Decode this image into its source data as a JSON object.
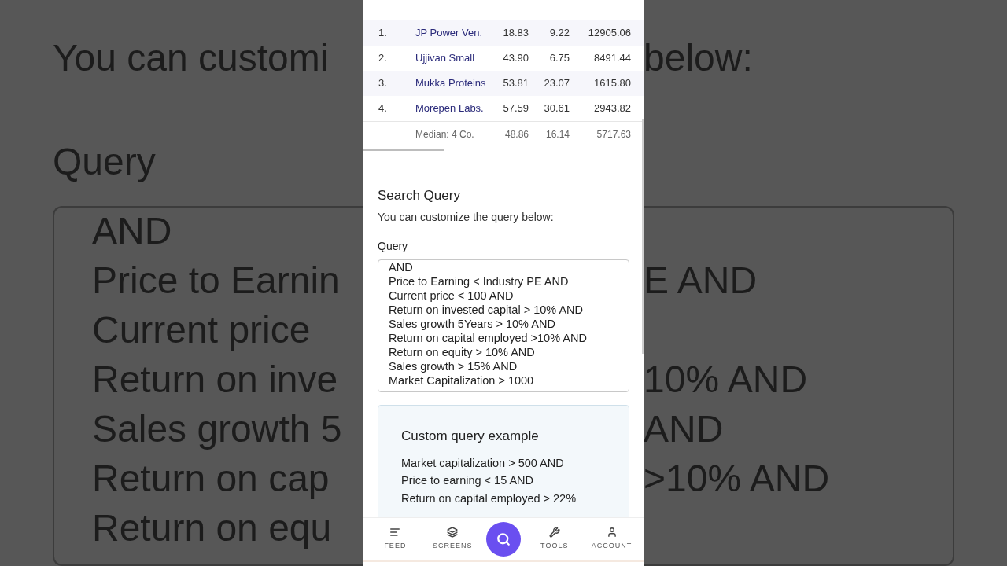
{
  "background": {
    "left_lines": [
      {
        "text": "You can customi",
        "kind": "heading"
      },
      {
        "text": "Query",
        "kind": "label"
      },
      {
        "text": "AND",
        "kind": "box"
      },
      {
        "text": "Price to Earnin",
        "kind": "box"
      },
      {
        "text": "Current price",
        "kind": "box"
      },
      {
        "text": "Return on inve",
        "kind": "box"
      },
      {
        "text": "Sales growth 5",
        "kind": "box"
      },
      {
        "text": "Return on cap",
        "kind": "box"
      },
      {
        "text": "Return on equ",
        "kind": "box"
      }
    ],
    "right_lines": [
      {
        "text": "below:",
        "kind": "heading"
      },
      {
        "kind": "label"
      },
      {
        "kind": "box"
      },
      {
        "text": "E AND",
        "kind": "box"
      },
      {
        "kind": "box"
      },
      {
        "text": "10% AND",
        "kind": "box"
      },
      {
        "text": "AND",
        "kind": "box"
      },
      {
        "text": ">10% AND",
        "kind": "box"
      }
    ]
  },
  "table": {
    "rows": [
      {
        "rank": "1.",
        "name": "JP Power Ven.",
        "column_3": "18.83",
        "column_4": "9.22",
        "column_5": "12905.06"
      },
      {
        "rank": "2.",
        "name": "Ujjivan Small",
        "column_3": "43.90",
        "column_4": "6.75",
        "column_5": "8491.44"
      },
      {
        "rank": "3.",
        "name": "Mukka Proteins",
        "column_3": "53.81",
        "column_4": "23.07",
        "column_5": "1615.80"
      },
      {
        "rank": "4.",
        "name": "Morepen Labs.",
        "column_3": "57.59",
        "column_4": "30.61",
        "column_5": "2943.82"
      }
    ],
    "median": {
      "label": "Median: 4 Co.",
      "column_3": "48.86",
      "column_4": "16.14",
      "column_5": "5717.63"
    }
  },
  "search_query": {
    "title": "Search Query",
    "description": "You can customize the query below:",
    "field_label": "Query",
    "query_lines": [
      "AND",
      "Price to Earning < Industry PE AND",
      "Current price < 100 AND",
      "Return on invested capital > 10% AND",
      "Sales growth 5Years > 10% AND",
      "Return on capital employed >10% AND",
      "Return on equity > 10% AND",
      "Sales growth > 15% AND",
      "Market Capitalization > 1000"
    ]
  },
  "example": {
    "title": "Custom query example",
    "lines": [
      "Market capitalization > 500 AND",
      "Price to earning < 15 AND",
      "Return on capital employed > 22%"
    ]
  },
  "bottom_nav": [
    {
      "kind": "feed",
      "label": "FEED"
    },
    {
      "kind": "screens",
      "label": "SCREENS"
    },
    {
      "kind": "search"
    },
    {
      "kind": "tools",
      "label": "TOOLS"
    },
    {
      "kind": "account",
      "label": "ACCOUNT"
    }
  ]
}
